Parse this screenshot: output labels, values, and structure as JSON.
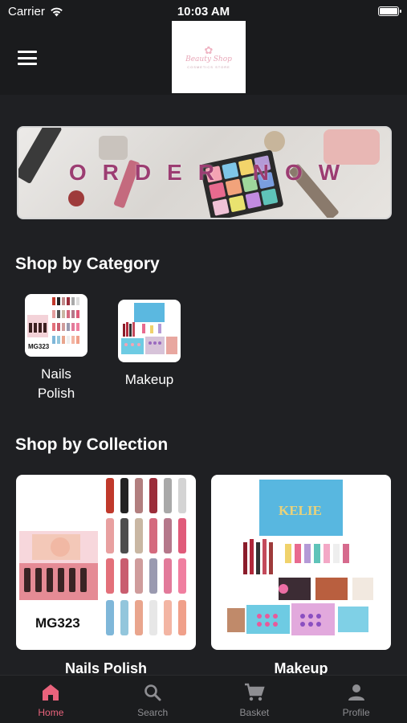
{
  "status_bar": {
    "carrier": "Carrier",
    "time": "10:03 AM"
  },
  "header": {
    "logo_text": "Beauty Shop",
    "logo_sub": "COSMETICS STORE"
  },
  "banner": {
    "text": "ORDER NOW"
  },
  "categories": {
    "title": "Shop by Category",
    "items": [
      {
        "label": "Nails Polish",
        "thumb_code": "MG323"
      },
      {
        "label": "Makeup"
      }
    ]
  },
  "collections": {
    "title": "Shop by Collection",
    "items": [
      {
        "label": "Nails Polish",
        "code": "MG323"
      },
      {
        "label": "Makeup",
        "brand": "KELIE"
      }
    ]
  },
  "tabbar": {
    "tabs": [
      {
        "label": "Home",
        "icon": "home-icon",
        "active": true
      },
      {
        "label": "Search",
        "icon": "search-icon"
      },
      {
        "label": "Basket",
        "icon": "cart-icon"
      },
      {
        "label": "Profile",
        "icon": "person-icon"
      }
    ]
  },
  "colors": {
    "accent": "#e9637c",
    "background": "#1f2023",
    "banner_text": "#9c3d72"
  }
}
